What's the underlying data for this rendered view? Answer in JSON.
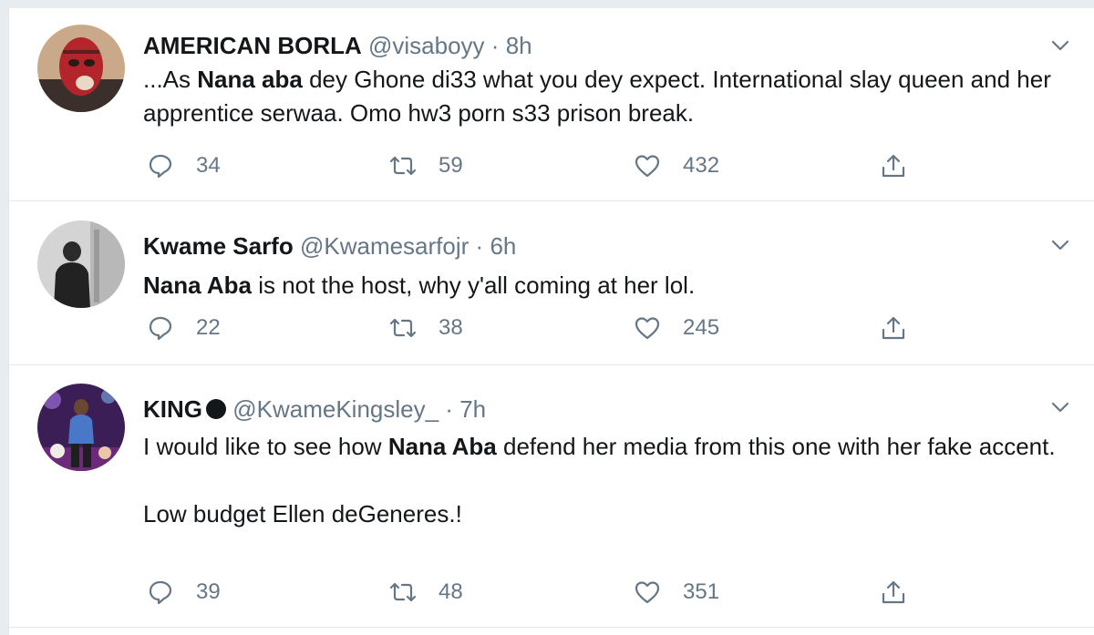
{
  "colors": {
    "text": "#14171a",
    "secondary": "#657786",
    "border": "#e1e8ed",
    "page_bg": "#e6ecf0"
  },
  "tweets": [
    {
      "name": "AMERICAN BORLA",
      "handle": "@visaboyy",
      "separator": "·",
      "time": "8h",
      "avatar_icon": "avatar-red-balaclava",
      "paragraphs": [
        [
          {
            "text": "...As ",
            "bold": false
          },
          {
            "text": "Nana aba",
            "bold": true
          },
          {
            "text": " dey Ghone di33 what you dey expect. International slay queen and her apprentice serwaa. Omo hw3 porn s33 prison break.",
            "bold": false
          }
        ]
      ],
      "replies": "34",
      "retweets": "59",
      "likes": "432"
    },
    {
      "name": "Kwame Sarfo",
      "handle": "@Kwamesarfojr",
      "separator": "·",
      "time": "6h",
      "avatar_icon": "avatar-person-dark",
      "paragraphs": [
        [
          {
            "text": "Nana Aba",
            "bold": true
          },
          {
            "text": " is not the host, why y'all coming at her lol.",
            "bold": false
          }
        ]
      ],
      "replies": "22",
      "retweets": "38",
      "likes": "245"
    },
    {
      "name": "KING",
      "verified_icon": "black-circle-icon",
      "handle": "@KwameKingsley_",
      "separator": "·",
      "time": "7h",
      "avatar_icon": "avatar-stage-performer",
      "paragraphs": [
        [
          {
            "text": "I would like to see how ",
            "bold": false
          },
          {
            "text": "Nana Aba",
            "bold": true
          },
          {
            "text": " defend her media from this one with her fake accent.",
            "bold": false
          }
        ],
        [
          {
            "text": "Low budget Ellen deGeneres.!",
            "bold": false
          }
        ]
      ],
      "replies": "39",
      "retweets": "48",
      "likes": "351"
    }
  ],
  "icons": {
    "reply": "reply-icon",
    "retweet": "retweet-icon",
    "like": "heart-icon",
    "share": "share-icon",
    "menu": "chevron-down-icon"
  }
}
